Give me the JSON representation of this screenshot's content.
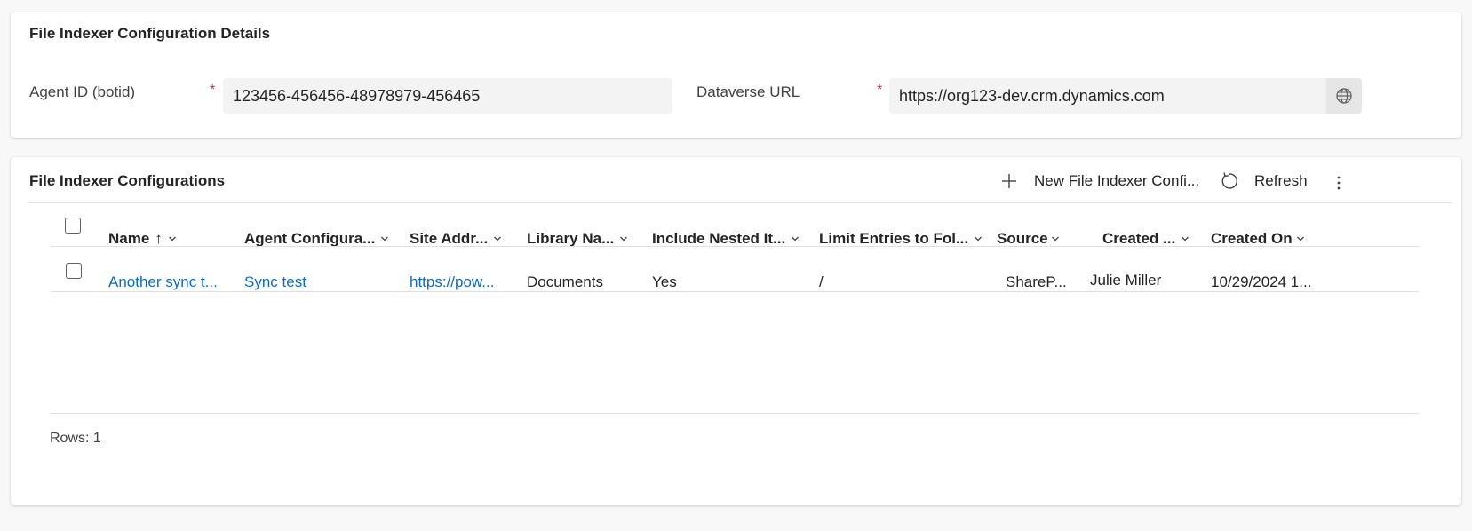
{
  "details": {
    "title": "File Indexer Configuration Details",
    "agent_id_label": "Agent ID (botid)",
    "agent_id_value": "123456-456456-48978979-456465",
    "dataverse_url_label": "Dataverse URL",
    "dataverse_url_value": "https://org123-dev.crm.dynamics.com",
    "required_marker": "*"
  },
  "grid": {
    "title": "File Indexer Configurations",
    "commands": {
      "new_label": "New File Indexer Confi...",
      "refresh_label": "Refresh"
    },
    "columns": [
      "Name",
      "Agent Configura...",
      "Site Addr...",
      "Library Na...",
      "Include Nested It...",
      "Limit Entries to Fol...",
      "Source",
      "Created ...",
      "Created On"
    ],
    "sort_indicator": "↑",
    "rows": [
      {
        "name": "Another sync t...",
        "agent_configuration": "Sync test",
        "site_address": "https://pow...",
        "library_name": "Documents",
        "include_nested": "Yes",
        "limit_entries": "/",
        "source": "ShareP...",
        "created_by": "Julie Miller",
        "created_on": "10/29/2024 1..."
      }
    ],
    "footer": "Rows: 1"
  },
  "colors": {
    "link": "#0f6cbd",
    "required": "#c4314b",
    "background": "#f8f8f8"
  },
  "icons": [
    "add-icon",
    "refresh-icon",
    "more-vertical-icon",
    "globe-icon",
    "chevron-down-icon",
    "sort-up-arrow-icon"
  ]
}
